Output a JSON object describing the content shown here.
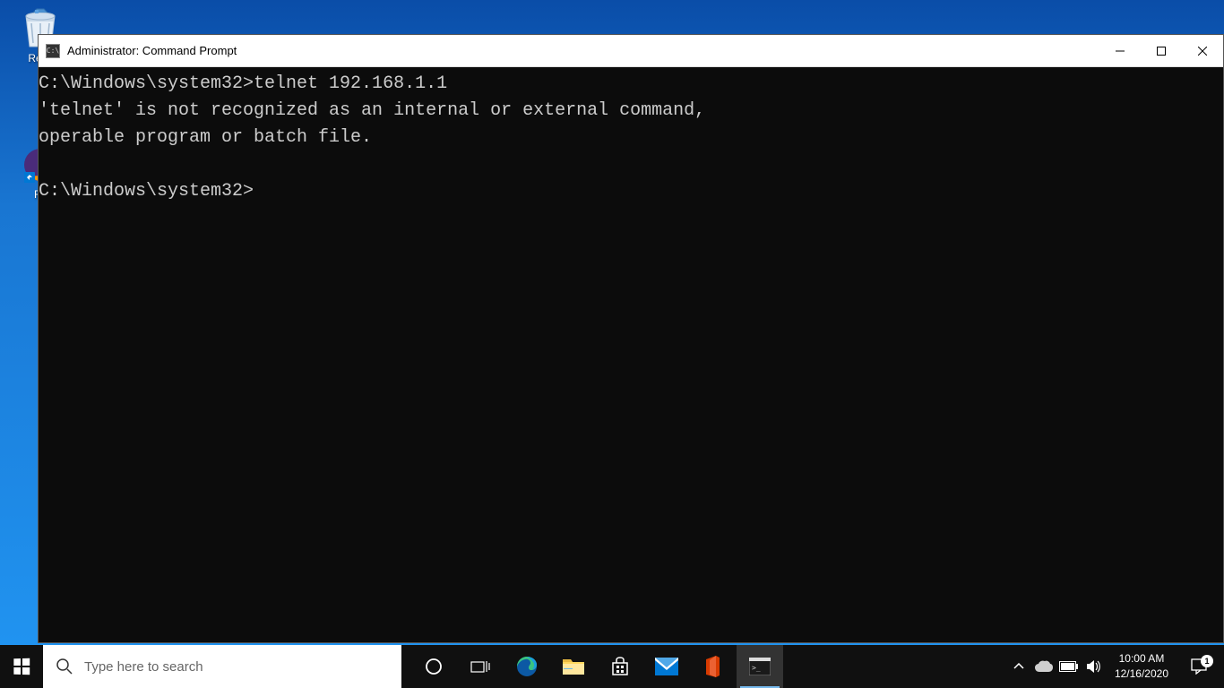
{
  "desktop": {
    "recycle_bin_label": "Recy",
    "firefox_label": "Fir"
  },
  "cmd": {
    "title": "Administrator: Command Prompt",
    "lines": [
      "C:\\Windows\\system32>telnet 192.168.1.1",
      "'telnet' is not recognized as an internal or external command,",
      "operable program or batch file.",
      "",
      "C:\\Windows\\system32>"
    ]
  },
  "taskbar": {
    "search_placeholder": "Type here to search",
    "time": "10:00 AM",
    "date": "12/16/2020",
    "notification_count": "1"
  }
}
